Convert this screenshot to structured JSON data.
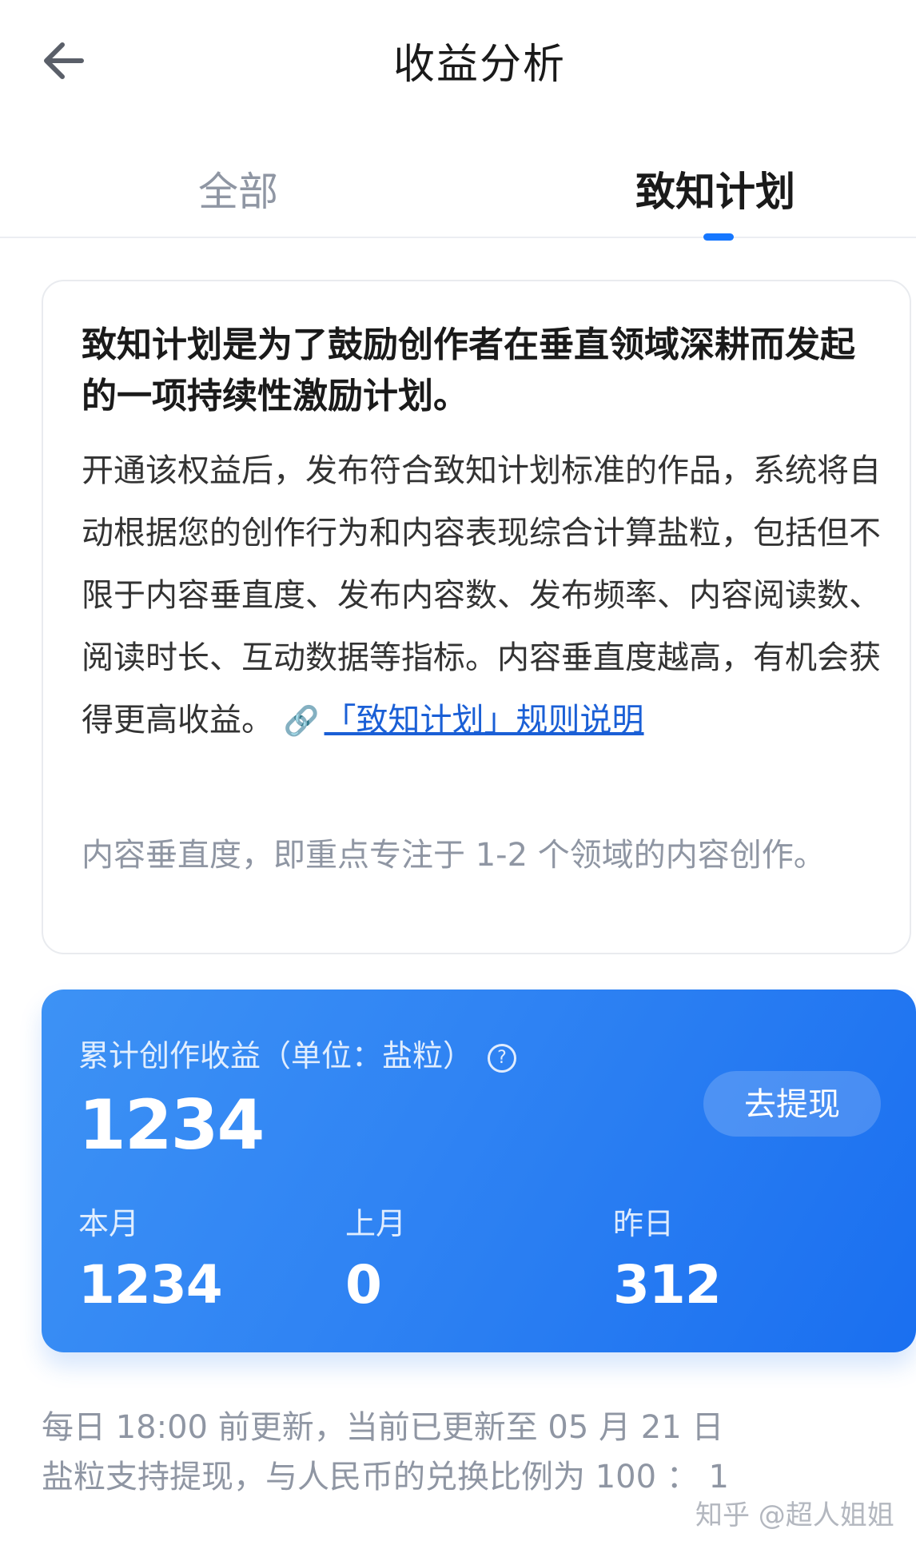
{
  "header": {
    "title": "收益分析",
    "back_icon": "arrow-left-icon"
  },
  "tabs": [
    {
      "label": "全部",
      "active": false
    },
    {
      "label": "致知计划",
      "active": true
    }
  ],
  "info": {
    "headline": "致知计划是为了鼓励创作者在垂直领域深耕而发起的一项持续性激励计划。",
    "body": "开通该权益后，发布符合致知计划标准的作品，系统将自动根据您的创作行为和内容表现综合计算盐粒，包括但不限于内容垂直度、发布内容数、发布频率、内容阅读数、阅读时长、互动数据等指标。内容垂直度越高，有机会获得更高收益。",
    "link_icon": "🔗",
    "link_text": "「致知计划」规则说明",
    "note": "内容垂直度，即重点专注于 1-2 个领域的内容创作。"
  },
  "earnings": {
    "label": "累计创作收益（单位：盐粒）",
    "help_icon": "?",
    "total": "1234",
    "withdraw_label": "去提现",
    "stats": [
      {
        "label": "本月",
        "value": "1234"
      },
      {
        "label": "上月",
        "value": "0"
      },
      {
        "label": "昨日",
        "value": "312"
      }
    ],
    "colors": {
      "card_start": "#3d92f5",
      "card_end": "#1a6ff0"
    }
  },
  "footer": {
    "update_note": "每日 18:00 前更新，当前已更新至 05 月 21 日",
    "exchange_note": "盐粒支持提现，与人民币的兑换比例为 100 ： 1"
  },
  "watermark": "知乎 @超人姐姐"
}
